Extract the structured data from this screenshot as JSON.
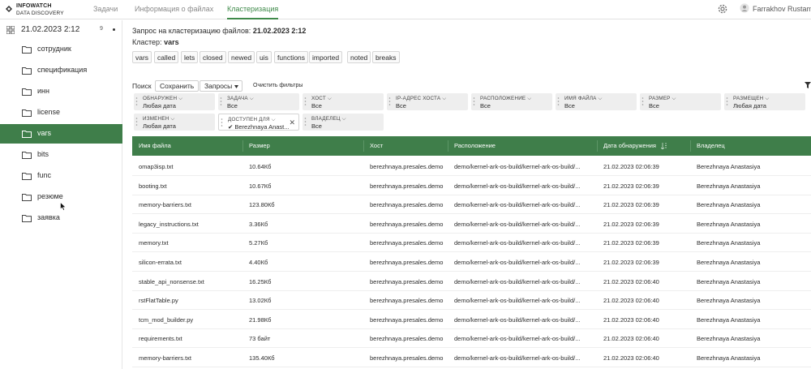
{
  "app": {
    "logo_line1": "INFOWATCH",
    "logo_line2": "DATA DISCOVERY",
    "accent_color": "#3f7e4a"
  },
  "nav": {
    "tabs": [
      {
        "label": "Задачи"
      },
      {
        "label": "Информация о файлах"
      },
      {
        "label": "Кластеризация"
      }
    ],
    "active_tab": "Кластеризация",
    "user_name": "Farrakhov Rustam"
  },
  "sidebar": {
    "date": "21.02.2023 2:12",
    "count": "9",
    "items": [
      {
        "label": "сотрудник"
      },
      {
        "label": "спецификация"
      },
      {
        "label": "инн"
      },
      {
        "label": "license"
      },
      {
        "label": "vars"
      },
      {
        "label": "bits"
      },
      {
        "label": "func"
      },
      {
        "label": "резюме"
      },
      {
        "label": "заявка"
      }
    ],
    "active_item": "vars"
  },
  "main": {
    "request_label": "Запрос на кластеризацию файлов:",
    "request_value": "21.02.2023 2:12",
    "cluster_label": "Кластер:",
    "cluster_value": "vars",
    "keywords": [
      "vars",
      "called",
      "lets",
      "closed",
      "newed",
      "uis",
      "functions",
      "imported",
      "noted",
      "breaks"
    ],
    "toolbar": {
      "search_label": "Поиск",
      "save_label": "Сохранить",
      "queries_label": "Запросы",
      "clear_label": "Очистить фильтры"
    },
    "filters": [
      {
        "key": "ОБНАРУЖЕН",
        "value": "Любая дата"
      },
      {
        "key": "ЗАДАЧА",
        "value": "Все"
      },
      {
        "key": "ХОСТ",
        "value": "Все"
      },
      {
        "key": "IP-АДРЕС ХОСТА",
        "value": "Все"
      },
      {
        "key": "РАСПОЛОЖЕНИЕ",
        "value": "Все"
      },
      {
        "key": "ИМЯ ФАЙЛА",
        "value": "Все"
      },
      {
        "key": "РАЗМЕР",
        "value": "Все"
      },
      {
        "key": "РАЗМЕЩЕН",
        "value": "Любая дата"
      },
      {
        "key": "ИЗМЕНЕН",
        "value": "Любая дата"
      },
      {
        "key": "ДОСТУПЕН ДЛЯ",
        "value": "✔ Berezhnaya Anast..."
      },
      {
        "key": "ВЛАДЕЛЕЦ",
        "value": "Все"
      }
    ],
    "table": {
      "columns": [
        "Имя файла",
        "Размер",
        "Хост",
        "Расположение",
        "Дата обнаружения",
        "Владелец"
      ],
      "rows": [
        [
          "omap3isp.txt",
          "10.64Кб",
          "berezhnaya.presales.demo",
          "demo/kernel-ark-os-build/kernel-ark-os-build/...",
          "21.02.2023 02:06:39",
          "Berezhnaya Anastasiya"
        ],
        [
          "booting.txt",
          "10.67Кб",
          "berezhnaya.presales.demo",
          "demo/kernel-ark-os-build/kernel-ark-os-build/...",
          "21.02.2023 02:06:39",
          "Berezhnaya Anastasiya"
        ],
        [
          "memory-barriers.txt",
          "123.80Кб",
          "berezhnaya.presales.demo",
          "demo/kernel-ark-os-build/kernel-ark-os-build/...",
          "21.02.2023 02:06:39",
          "Berezhnaya Anastasiya"
        ],
        [
          "legacy_instructions.txt",
          "3.36Кб",
          "berezhnaya.presales.demo",
          "demo/kernel-ark-os-build/kernel-ark-os-build/...",
          "21.02.2023 02:06:39",
          "Berezhnaya Anastasiya"
        ],
        [
          "memory.txt",
          "5.27Кб",
          "berezhnaya.presales.demo",
          "demo/kernel-ark-os-build/kernel-ark-os-build/...",
          "21.02.2023 02:06:39",
          "Berezhnaya Anastasiya"
        ],
        [
          "silicon-errata.txt",
          "4.40Кб",
          "berezhnaya.presales.demo",
          "demo/kernel-ark-os-build/kernel-ark-os-build/...",
          "21.02.2023 02:06:39",
          "Berezhnaya Anastasiya"
        ],
        [
          "stable_api_nonsense.txt",
          "16.25Кб",
          "berezhnaya.presales.demo",
          "demo/kernel-ark-os-build/kernel-ark-os-build/...",
          "21.02.2023 02:06:40",
          "Berezhnaya Anastasiya"
        ],
        [
          "rstFlatTable.py",
          "13.02Кб",
          "berezhnaya.presales.demo",
          "demo/kernel-ark-os-build/kernel-ark-os-build/...",
          "21.02.2023 02:06:40",
          "Berezhnaya Anastasiya"
        ],
        [
          "tcm_mod_builder.py",
          "21.98Кб",
          "berezhnaya.presales.demo",
          "demo/kernel-ark-os-build/kernel-ark-os-build/...",
          "21.02.2023 02:06:40",
          "Berezhnaya Anastasiya"
        ],
        [
          "requirements.txt",
          "73 байт",
          "berezhnaya.presales.demo",
          "demo/kernel-ark-os-build/kernel-ark-os-build/...",
          "21.02.2023 02:06:40",
          "Berezhnaya Anastasiya"
        ],
        [
          "memory-barriers.txt",
          "135.40Кб",
          "berezhnaya.presales.demo",
          "demo/kernel-ark-os-build/kernel-ark-os-build/...",
          "21.02.2023 02:06:40",
          "Berezhnaya Anastasiya"
        ]
      ]
    }
  }
}
